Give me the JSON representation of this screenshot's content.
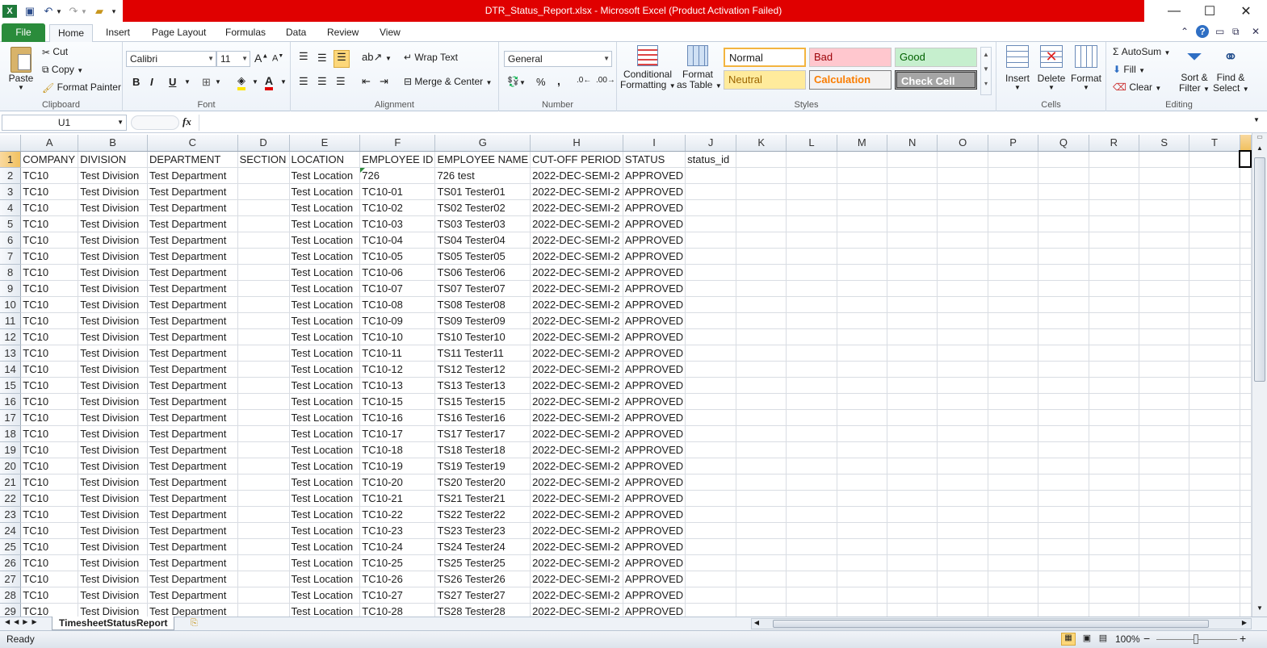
{
  "window": {
    "title": "DTR_Status_Report.xlsx  -  Microsoft Excel (Product Activation Failed)",
    "minimize": "—",
    "maximize": "☐",
    "close": "✕"
  },
  "tabs": [
    "File",
    "Home",
    "Insert",
    "Page Layout",
    "Formulas",
    "Data",
    "Review",
    "View"
  ],
  "ribbon": {
    "clipboard": {
      "label": "Clipboard",
      "paste": "Paste",
      "cut": "Cut",
      "copy": "Copy",
      "format_painter": "Format Painter"
    },
    "font": {
      "label": "Font",
      "name": "Calibri",
      "size": "11"
    },
    "alignment": {
      "label": "Alignment",
      "wrap_text": "Wrap Text",
      "merge_center": "Merge & Center"
    },
    "number": {
      "label": "Number",
      "format": "General"
    },
    "styles": {
      "label": "Styles",
      "conditional_formatting_1": "Conditional",
      "conditional_formatting_2": "Formatting",
      "format_table_1": "Format",
      "format_table_2": "as Table",
      "normal": "Normal",
      "bad": "Bad",
      "good": "Good",
      "neutral": "Neutral",
      "calculation": "Calculation",
      "check_cell": "Check Cell"
    },
    "cells": {
      "label": "Cells",
      "insert": "Insert",
      "delete": "Delete",
      "format": "Format"
    },
    "editing": {
      "label": "Editing",
      "autosum": "AutoSum",
      "fill": "Fill",
      "clear": "Clear",
      "sort_1": "Sort &",
      "sort_2": "Filter",
      "find_1": "Find &",
      "find_2": "Select"
    }
  },
  "formula_bar": {
    "name_box": "U1",
    "fx": "fx",
    "formula": ""
  },
  "columns": [
    "A",
    "B",
    "C",
    "D",
    "E",
    "F",
    "G",
    "H",
    "I",
    "J",
    "K",
    "L",
    "M",
    "N",
    "O",
    "P",
    "Q",
    "R",
    "S",
    "T"
  ],
  "header_row": [
    "COMPANY",
    "DIVISION",
    "DEPARTMENT",
    "SECTION",
    "LOCATION",
    "EMPLOYEE ID",
    "EMPLOYEE NAME",
    "CUT-OFF PERIOD",
    "STATUS",
    "status_id"
  ],
  "rows": [
    [
      "TC10",
      "Test Division",
      "Test Department",
      "",
      "Test Location",
      "726",
      "726 test",
      "2022-DEC-SEMI-2",
      "APPROVED",
      ""
    ],
    [
      "TC10",
      "Test Division",
      "Test Department",
      "",
      "Test Location",
      "TC10-01",
      "TS01 Tester01",
      "2022-DEC-SEMI-2",
      "APPROVED",
      ""
    ],
    [
      "TC10",
      "Test Division",
      "Test Department",
      "",
      "Test Location",
      "TC10-02",
      "TS02 Tester02",
      "2022-DEC-SEMI-2",
      "APPROVED",
      ""
    ],
    [
      "TC10",
      "Test Division",
      "Test Department",
      "",
      "Test Location",
      "TC10-03",
      "TS03 Tester03",
      "2022-DEC-SEMI-2",
      "APPROVED",
      ""
    ],
    [
      "TC10",
      "Test Division",
      "Test Department",
      "",
      "Test Location",
      "TC10-04",
      "TS04 Tester04",
      "2022-DEC-SEMI-2",
      "APPROVED",
      ""
    ],
    [
      "TC10",
      "Test Division",
      "Test Department",
      "",
      "Test Location",
      "TC10-05",
      "TS05 Tester05",
      "2022-DEC-SEMI-2",
      "APPROVED",
      ""
    ],
    [
      "TC10",
      "Test Division",
      "Test Department",
      "",
      "Test Location",
      "TC10-06",
      "TS06 Tester06",
      "2022-DEC-SEMI-2",
      "APPROVED",
      ""
    ],
    [
      "TC10",
      "Test Division",
      "Test Department",
      "",
      "Test Location",
      "TC10-07",
      "TS07 Tester07",
      "2022-DEC-SEMI-2",
      "APPROVED",
      ""
    ],
    [
      "TC10",
      "Test Division",
      "Test Department",
      "",
      "Test Location",
      "TC10-08",
      "TS08 Tester08",
      "2022-DEC-SEMI-2",
      "APPROVED",
      ""
    ],
    [
      "TC10",
      "Test Division",
      "Test Department",
      "",
      "Test Location",
      "TC10-09",
      "TS09 Tester09",
      "2022-DEC-SEMI-2",
      "APPROVED",
      ""
    ],
    [
      "TC10",
      "Test Division",
      "Test Department",
      "",
      "Test Location",
      "TC10-10",
      "TS10 Tester10",
      "2022-DEC-SEMI-2",
      "APPROVED",
      ""
    ],
    [
      "TC10",
      "Test Division",
      "Test Department",
      "",
      "Test Location",
      "TC10-11",
      "TS11 Tester11",
      "2022-DEC-SEMI-2",
      "APPROVED",
      ""
    ],
    [
      "TC10",
      "Test Division",
      "Test Department",
      "",
      "Test Location",
      "TC10-12",
      "TS12 Tester12",
      "2022-DEC-SEMI-2",
      "APPROVED",
      ""
    ],
    [
      "TC10",
      "Test Division",
      "Test Department",
      "",
      "Test Location",
      "TC10-13",
      "TS13 Tester13",
      "2022-DEC-SEMI-2",
      "APPROVED",
      ""
    ],
    [
      "TC10",
      "Test Division",
      "Test Department",
      "",
      "Test Location",
      "TC10-15",
      "TS15 Tester15",
      "2022-DEC-SEMI-2",
      "APPROVED",
      ""
    ],
    [
      "TC10",
      "Test Division",
      "Test Department",
      "",
      "Test Location",
      "TC10-16",
      "TS16 Tester16",
      "2022-DEC-SEMI-2",
      "APPROVED",
      ""
    ],
    [
      "TC10",
      "Test Division",
      "Test Department",
      "",
      "Test Location",
      "TC10-17",
      "TS17 Tester17",
      "2022-DEC-SEMI-2",
      "APPROVED",
      ""
    ],
    [
      "TC10",
      "Test Division",
      "Test Department",
      "",
      "Test Location",
      "TC10-18",
      "TS18 Tester18",
      "2022-DEC-SEMI-2",
      "APPROVED",
      ""
    ],
    [
      "TC10",
      "Test Division",
      "Test Department",
      "",
      "Test Location",
      "TC10-19",
      "TS19 Tester19",
      "2022-DEC-SEMI-2",
      "APPROVED",
      ""
    ],
    [
      "TC10",
      "Test Division",
      "Test Department",
      "",
      "Test Location",
      "TC10-20",
      "TS20 Tester20",
      "2022-DEC-SEMI-2",
      "APPROVED",
      ""
    ],
    [
      "TC10",
      "Test Division",
      "Test Department",
      "",
      "Test Location",
      "TC10-21",
      "TS21 Tester21",
      "2022-DEC-SEMI-2",
      "APPROVED",
      ""
    ],
    [
      "TC10",
      "Test Division",
      "Test Department",
      "",
      "Test Location",
      "TC10-22",
      "TS22 Tester22",
      "2022-DEC-SEMI-2",
      "APPROVED",
      ""
    ],
    [
      "TC10",
      "Test Division",
      "Test Department",
      "",
      "Test Location",
      "TC10-23",
      "TS23 Tester23",
      "2022-DEC-SEMI-2",
      "APPROVED",
      ""
    ],
    [
      "TC10",
      "Test Division",
      "Test Department",
      "",
      "Test Location",
      "TC10-24",
      "TS24 Tester24",
      "2022-DEC-SEMI-2",
      "APPROVED",
      ""
    ],
    [
      "TC10",
      "Test Division",
      "Test Department",
      "",
      "Test Location",
      "TC10-25",
      "TS25 Tester25",
      "2022-DEC-SEMI-2",
      "APPROVED",
      ""
    ],
    [
      "TC10",
      "Test Division",
      "Test Department",
      "",
      "Test Location",
      "TC10-26",
      "TS26 Tester26",
      "2022-DEC-SEMI-2",
      "APPROVED",
      ""
    ],
    [
      "TC10",
      "Test Division",
      "Test Department",
      "",
      "Test Location",
      "TC10-27",
      "TS27 Tester27",
      "2022-DEC-SEMI-2",
      "APPROVED",
      ""
    ],
    [
      "TC10",
      "Test Division",
      "Test Department",
      "",
      "Test Location",
      "TC10-28",
      "TS28 Tester28",
      "2022-DEC-SEMI-2",
      "APPROVED",
      ""
    ]
  ],
  "sheet_tab": "TimesheetStatusReport",
  "status": {
    "ready": "Ready",
    "zoom": "100%",
    "zoom_minus": "−",
    "zoom_plus": "+"
  },
  "colors": {
    "title_bar": "#e00000",
    "file_tab": "#2a8c3b",
    "selected_header": "#f1c15f"
  }
}
